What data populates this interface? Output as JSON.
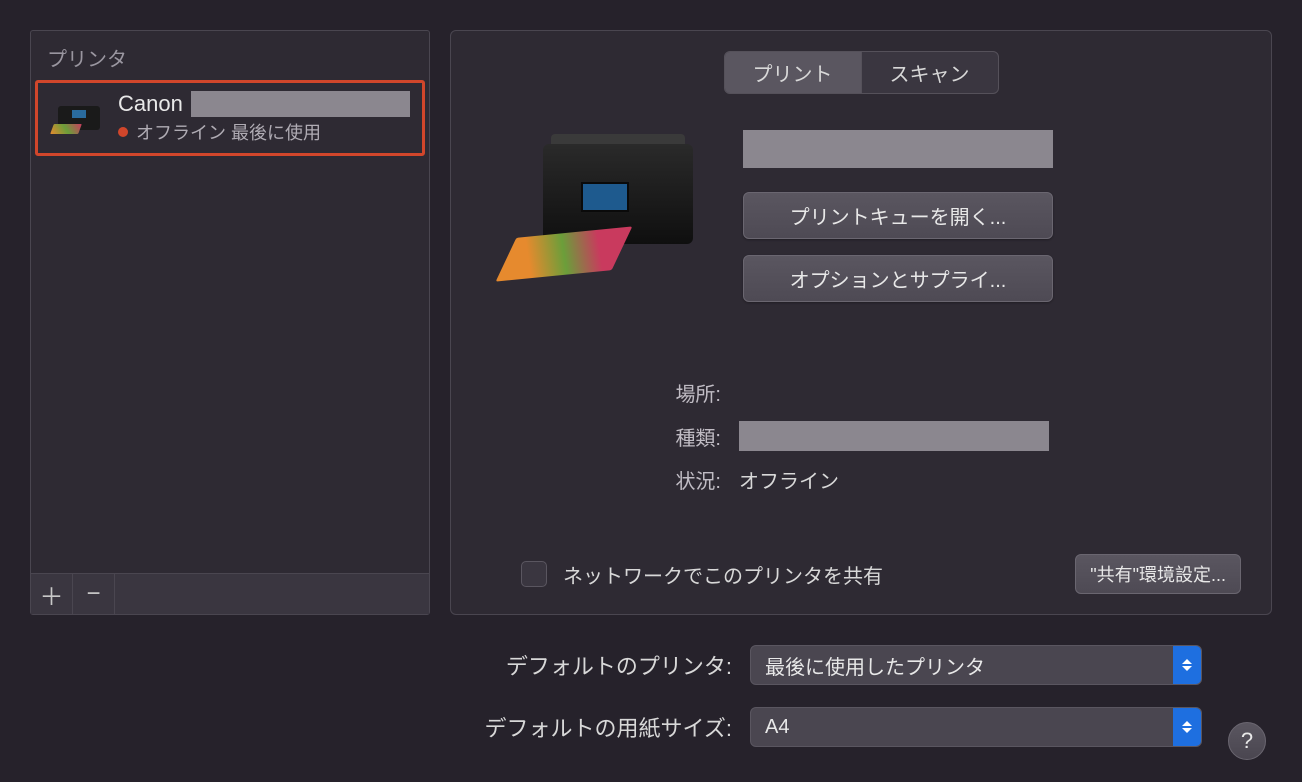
{
  "sidebar": {
    "header": "プリンタ",
    "printer": {
      "name": "Canon",
      "status": "オフライン 最後に使用"
    },
    "add_label": "＋",
    "remove_label": "−"
  },
  "tabs": {
    "print": "プリント",
    "scan": "スキャン"
  },
  "buttons": {
    "open_queue": "プリントキューを開く...",
    "options_supplies": "オプションとサプライ...",
    "sharing_prefs": "\"共有\"環境設定..."
  },
  "info": {
    "location_label": "場所:",
    "location_value": "",
    "kind_label": "種類:",
    "status_label": "状況:",
    "status_value": "オフライン"
  },
  "share": {
    "label": "ネットワークでこのプリンタを共有"
  },
  "defaults": {
    "printer_label": "デフォルトのプリンタ:",
    "printer_value": "最後に使用したプリンタ",
    "paper_label": "デフォルトの用紙サイズ:",
    "paper_value": "A4"
  },
  "help_label": "?"
}
